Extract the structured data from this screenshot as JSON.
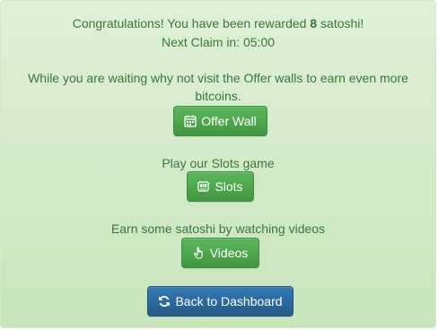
{
  "message": {
    "congrats_prefix": "Congratulations! You have been rewarded ",
    "reward_amount": "8",
    "congrats_suffix": " satoshi!",
    "next_claim": "Next Claim in: 05:00"
  },
  "offer_section": {
    "text": "While you are waiting why not visit the Offer walls to earn even more bitcoins.",
    "button_label": "Offer Wall",
    "button_icon": "calendar-icon"
  },
  "slots_section": {
    "text": "Play our Slots game",
    "button_label": "Slots",
    "button_icon": "slot-machine-icon"
  },
  "videos_section": {
    "text": "Earn some satoshi by watching videos",
    "button_label": "Videos",
    "button_icon": "hand-pointer-icon"
  },
  "dashboard": {
    "button_label": "Back to Dashboard",
    "button_icon": "refresh-icon"
  },
  "colors": {
    "panel_background": "#dff0d8",
    "panel_text": "#3c763d",
    "success_button": "#5cb85c",
    "primary_button": "#337ab7"
  }
}
